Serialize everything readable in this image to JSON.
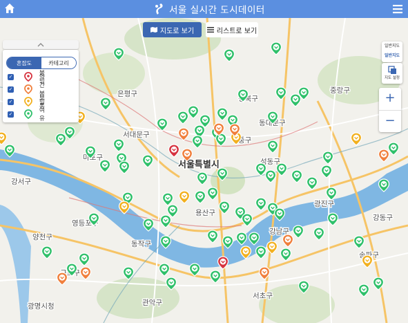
{
  "header": {
    "title": "서울 실시간 도시데이터",
    "home_icon": "home-icon",
    "menu_icon": "hamburger-menu-icon",
    "logo_icon": "seoul-logo-icon"
  },
  "view_toggle": {
    "map_view_label": "지도로 보기",
    "list_view_label": "리스트로 보기"
  },
  "legend": {
    "tabs": [
      "혼잡도",
      "카테고리"
    ],
    "active_tab": "혼잡도",
    "items": [
      {
        "label": "붐빔",
        "color": "#d6333f",
        "checked": true
      },
      {
        "label": "약간 붐빔",
        "color": "#f07f3c",
        "checked": true
      },
      {
        "label": "보통",
        "color": "#f2b01e",
        "checked": true
      },
      {
        "label": "여유",
        "color": "#2fc06a",
        "checked": true
      }
    ]
  },
  "map_controls": {
    "map_type_top": "일반지도",
    "map_type_bottom": "일반지도",
    "layer_label": "지도 설정",
    "zoom_in": "+",
    "zoom_out": "−"
  },
  "map_labels": {
    "districts": [
      "은평구",
      "서대문구",
      "마포구",
      "중구",
      "용산구",
      "성동구",
      "광진구",
      "동대문구",
      "중랑구",
      "성북구",
      "강서구",
      "양천구",
      "영등포구",
      "동작구",
      "관악구",
      "강남구",
      "서초구",
      "송파구",
      "강동구",
      "구로구",
      "광명시청"
    ],
    "city_hall": "서울특별시"
  },
  "colors": {
    "header_bg": "#5b8fe0",
    "accent": "#3b67b2",
    "river": "#7fb7e3",
    "crowded": "#d6333f",
    "slightly_crowded": "#f07f3c",
    "normal": "#f2b01e",
    "relaxed": "#2fc06a"
  }
}
